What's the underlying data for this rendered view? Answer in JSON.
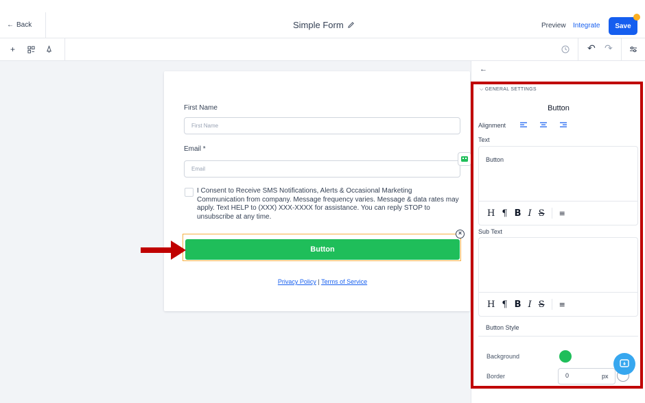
{
  "header": {
    "back_label": "Back",
    "title": "Simple Form",
    "preview_label": "Preview",
    "integrate_label": "Integrate",
    "save_label": "Save"
  },
  "form": {
    "first_name_label": "First Name",
    "first_name_placeholder": "First Name",
    "email_label": "Email *",
    "email_placeholder": "Email",
    "consent_text": "I Consent to Receive SMS Notifications, Alerts & Occasional Marketing Communication from company. Message frequency varies. Message & data rates may apply. Text HELP to (XXX) XXX-XXXX for assistance. You can reply STOP to unsubscribe at any time.",
    "button_label": "Button",
    "privacy_link": "Privacy Policy",
    "separator": "|",
    "terms_link": "Terms of Service"
  },
  "panel": {
    "section_title": "GENERAL SETTINGS",
    "element_title": "Button",
    "alignment_label": "Alignment",
    "text_label": "Text",
    "text_value": "Button",
    "subtext_label": "Sub Text",
    "subtext_value": "",
    "button_style_label": "Button Style",
    "background_label": "Background",
    "background_color": "#1fbe5a",
    "border_label": "Border",
    "border_value": "0",
    "border_unit": "px"
  },
  "colors": {
    "primary": "#155eef",
    "button_green": "#1fbe5a",
    "highlight_red": "#c00000"
  }
}
